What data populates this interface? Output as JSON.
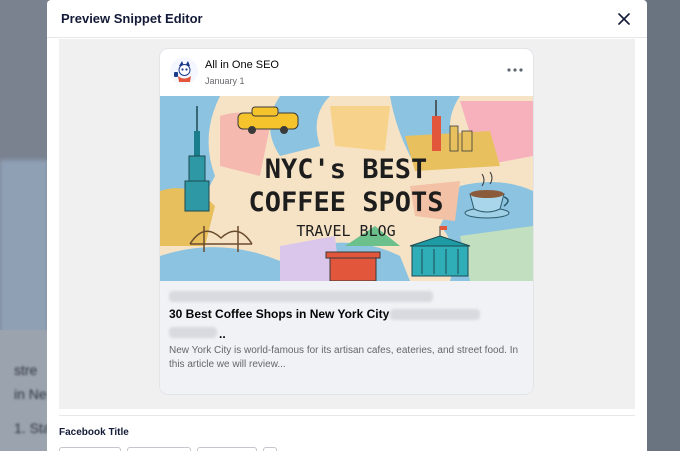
{
  "modal": {
    "title": "Preview Snippet Editor"
  },
  "post": {
    "author": "All in One SEO",
    "date": "January 1",
    "image_text": {
      "line1": "NYC's BEST",
      "line2": "COFFEE SPOTS",
      "line3": "TRAVEL BLOG"
    },
    "link_title": "30 Best Coffee Shops in New York City",
    "link_title_tail": "..",
    "link_description": "New York City is world-famous for its artisan cafes, eateries, and street food. In this article we will review..."
  },
  "form": {
    "facebook_title_label": "Facebook Title"
  },
  "background": {
    "text_lines": [
      "stre",
      "in Ne",
      "1. Sta"
    ]
  },
  "colors": {
    "card_bg": "#ffffff",
    "link_bg": "#f0f2f5",
    "preview_bg": "#f0f0f1",
    "title_text": "#141b38"
  }
}
